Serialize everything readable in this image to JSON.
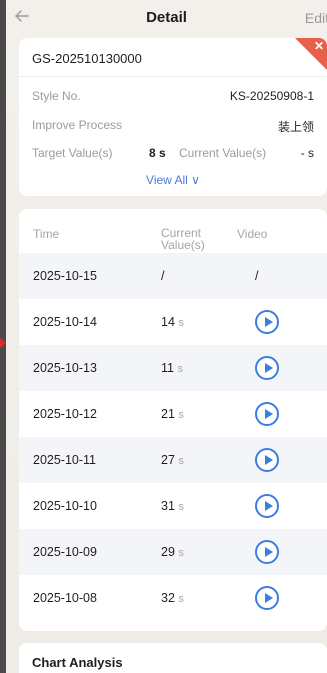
{
  "header": {
    "title": "Detail",
    "edit_label": "Edit"
  },
  "info": {
    "doc_no": "GS-202510130000",
    "style_label": "Style No.",
    "style_value": "KS-20250908-1",
    "process_label": "Improve Process",
    "process_value": "装上领",
    "target_label": "Target Value(s)",
    "target_value": "8 s",
    "current_label": "Current Value(s)",
    "current_value": "- s",
    "view_all": "View All ∨",
    "corner_icon": "close-icon",
    "corner_color": "#e8604a"
  },
  "table": {
    "headers": {
      "time": "Time",
      "current_line1": "Current",
      "current_line2": "Value(s)",
      "video": "Video"
    },
    "rows": [
      {
        "time": "2025-10-15",
        "value": "/",
        "unit": "",
        "video": "/"
      },
      {
        "time": "2025-10-14",
        "value": "14",
        "unit": "s",
        "video": "play-icon"
      },
      {
        "time": "2025-10-13",
        "value": "11",
        "unit": "s",
        "video": "play-icon"
      },
      {
        "time": "2025-10-12",
        "value": "21",
        "unit": "s",
        "video": "play-icon"
      },
      {
        "time": "2025-10-11",
        "value": "27",
        "unit": "s",
        "video": "play-icon"
      },
      {
        "time": "2025-10-10",
        "value": "31",
        "unit": "s",
        "video": "play-icon"
      },
      {
        "time": "2025-10-09",
        "value": "29",
        "unit": "s",
        "video": "play-icon"
      },
      {
        "time": "2025-10-08",
        "value": "32",
        "unit": "s",
        "video": "play-icon"
      }
    ]
  },
  "chart_section": {
    "title": "Chart Analysis"
  },
  "colors": {
    "accent_blue": "#3b7de0",
    "link_blue": "#4b7bd6",
    "alt_row": "#f3f5f8"
  }
}
